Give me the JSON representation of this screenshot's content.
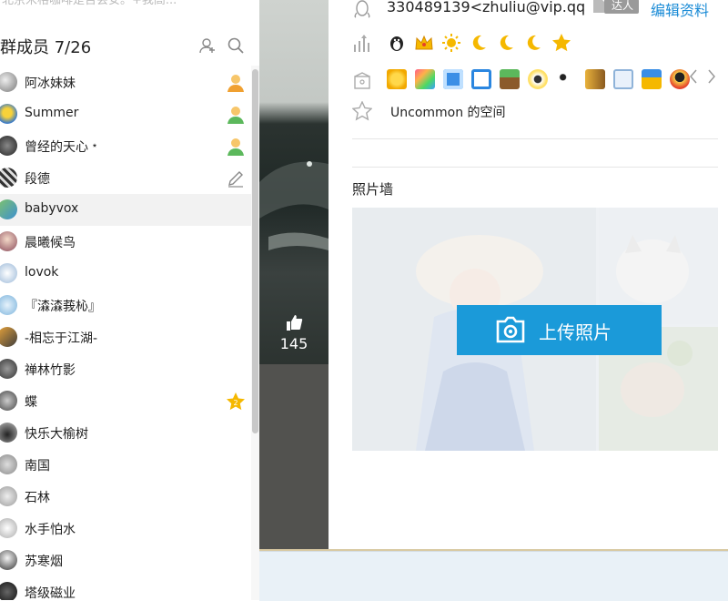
{
  "top_cut_text": "北京米格咖啡是否会安。+我高...",
  "members": {
    "title": "群成员 7/26",
    "list": [
      {
        "name": "阿冰妹妹",
        "role": "admin"
      },
      {
        "name": "Summer",
        "role": "admin"
      },
      {
        "name": "曾经的天心﹡",
        "role": "admin"
      },
      {
        "name": "段德",
        "role": "edit"
      },
      {
        "name": "babyvox",
        "role": ""
      },
      {
        "name": "晨曦候鸟",
        "role": ""
      },
      {
        "name": "lovok",
        "role": ""
      },
      {
        "name": "『潹潹莪杺』",
        "role": ""
      },
      {
        "name": "-相忘于江湖-",
        "role": ""
      },
      {
        "name": "禅林竹影",
        "role": ""
      },
      {
        "name": "蝶",
        "role": "star2"
      },
      {
        "name": "快乐大榆树",
        "role": ""
      },
      {
        "name": "南国",
        "role": ""
      },
      {
        "name": "石林",
        "role": ""
      },
      {
        "name": "水手怕水",
        "role": ""
      },
      {
        "name": "苏寒烟",
        "role": ""
      },
      {
        "name": "塔级磁业",
        "role": ""
      }
    ]
  },
  "likes": {
    "count": "145"
  },
  "profile": {
    "qq_text": "330489139<zhuliu@vip.qq",
    "talent_label": "达人",
    "edit_label": "编辑资料",
    "space_label": "Uncommon 的空间",
    "photo_wall_title": "照片墙",
    "upload_label": "上传照片"
  },
  "colors": {
    "accent": "#1b9ad9",
    "link": "#1a8bd6",
    "admin_icon": "#f0a030",
    "star": "#f5b800"
  },
  "icons": {
    "qq": "penguin-outline-icon",
    "level": "up-arrow-bars-icon",
    "apps": "gift-box-icon",
    "space": "star-outline-icon",
    "camera": "camera-icon",
    "thumb": "thumbs-up-icon"
  }
}
